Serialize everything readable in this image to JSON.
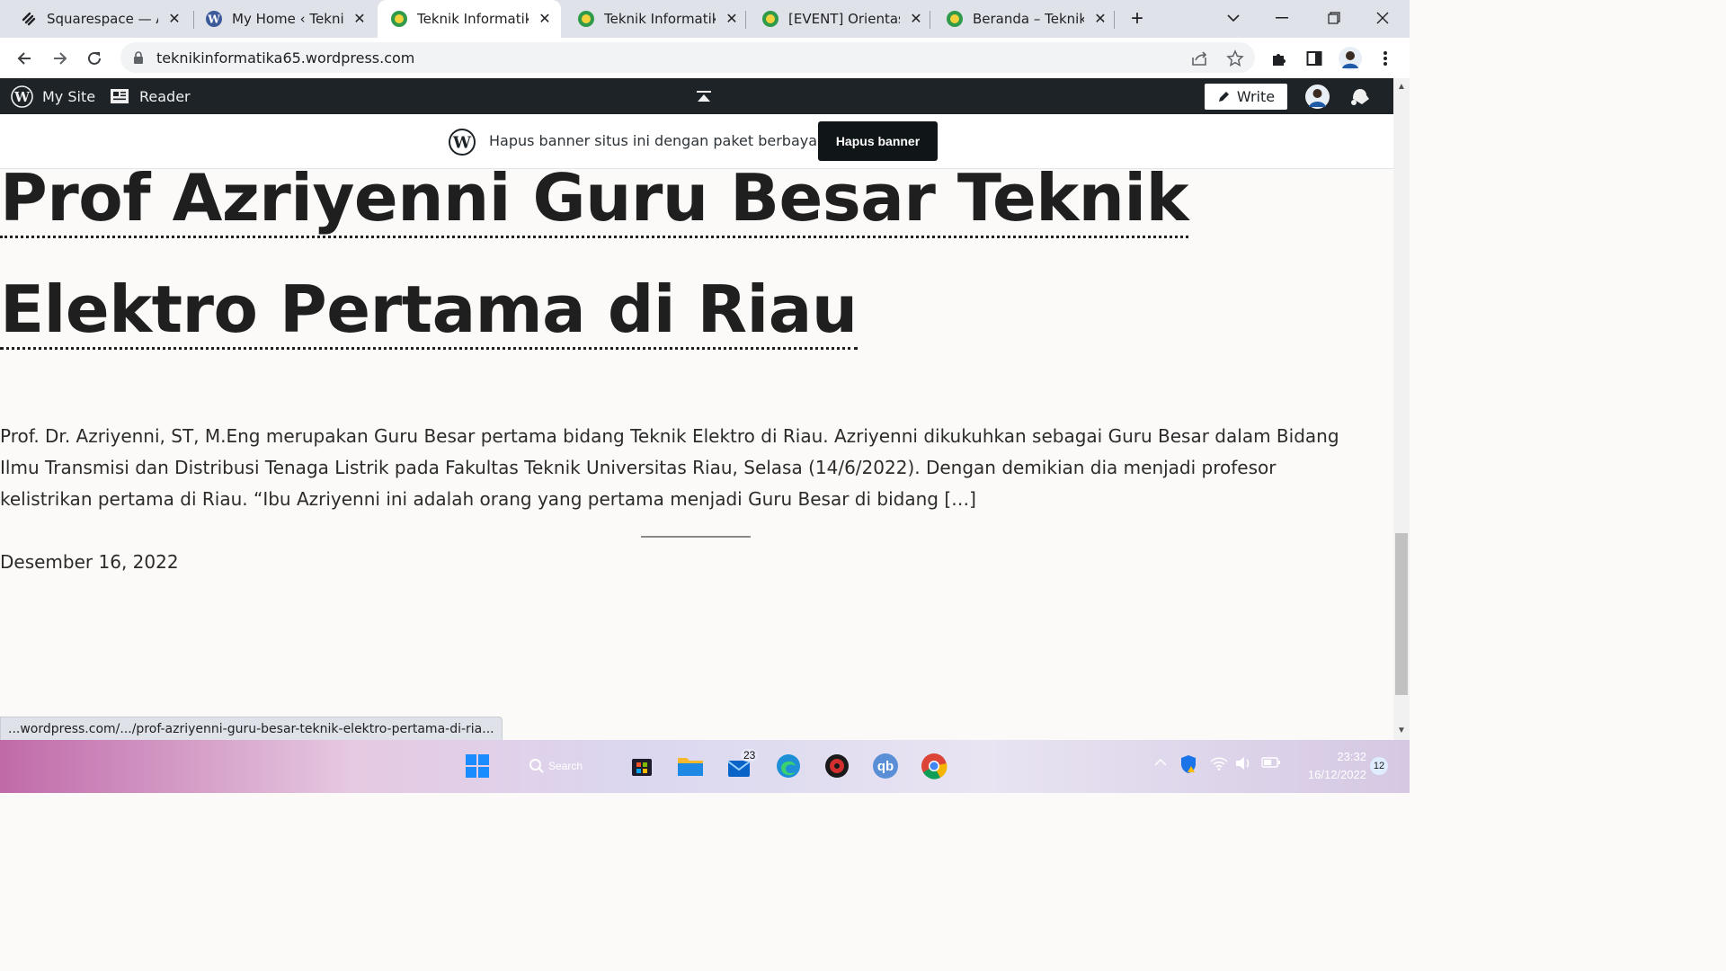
{
  "browser": {
    "tabs": [
      {
        "title": "Squarespace — Acc",
        "icon": "squarespace-icon"
      },
      {
        "title": "My Home ‹ Teknik I",
        "icon": "wordpress-icon"
      },
      {
        "title": "Teknik Informatika I",
        "icon": "site-icon",
        "active": true
      },
      {
        "title": "Teknik Informatika U",
        "icon": "site-icon"
      },
      {
        "title": "[EVENT] Orientasi P",
        "icon": "site-icon"
      },
      {
        "title": "Beranda – Teknik In",
        "icon": "site-icon"
      }
    ],
    "url": "teknikinformatika65.wordpress.com"
  },
  "adminbar": {
    "my_site": "My Site",
    "reader": "Reader",
    "write": "Write"
  },
  "banner": {
    "text": "Hapus banner situs ini dengan paket berbayar",
    "button": "Hapus banner"
  },
  "post": {
    "title_line1": "Prof Azriyenni Guru Besar Teknik",
    "title_line2": "Elektro Pertama di Riau",
    "excerpt": "Prof. Dr. Azriyenni, ST, M.Eng merupakan Guru Besar pertama bidang Teknik Elektro di Riau. Azriyenni dikukuhkan sebagai Guru Besar dalam Bidang Ilmu Transmisi dan Distribusi Tenaga Listrik pada Fakultas Teknik Universitas Riau, Selasa (14/6/2022). Dengan demikian dia menjadi profesor kelistrikan pertama di Riau. “Ibu Azriyenni ini adalah orang yang pertama menjadi Guru Besar di bidang […]",
    "date": "Desember 16, 2022"
  },
  "status_url": "...wordpress.com/.../prof-azriyenni-guru-besar-teknik-elektro-pertama-di-ria...",
  "taskbar": {
    "search_label": "Search",
    "badge_count": "23",
    "qb_label": "qb",
    "time": "23:32",
    "date": "16/12/2022",
    "notifications": "12"
  },
  "colors": {
    "tabstrip": "#dfe3e9",
    "adminbar": "#1d2327",
    "page_bg": "#fbfaf8",
    "banner_button": "#101517"
  }
}
